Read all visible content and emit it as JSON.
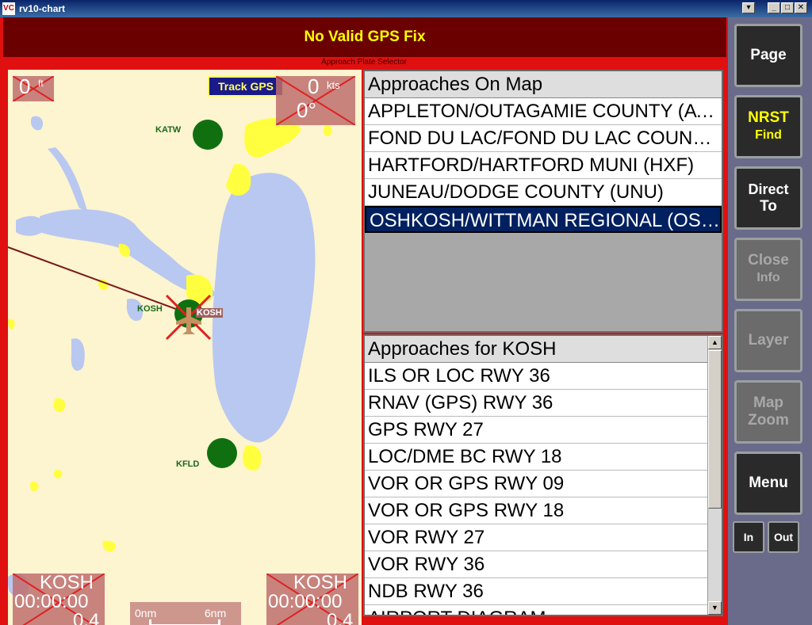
{
  "window": {
    "title": "rv10-chart",
    "app_icon": "VC"
  },
  "banner": {
    "text": "No Valid GPS Fix"
  },
  "selector_label": "Approach Plate Selector",
  "map": {
    "track_button": "Track GPS",
    "altitude": {
      "value": "0",
      "unit": "ft"
    },
    "speed": {
      "value": "0",
      "unit": "kts",
      "heading": "0°"
    },
    "airports": [
      {
        "id": "KATW"
      },
      {
        "id": "KOSH"
      },
      {
        "id": "KFLD"
      }
    ],
    "target_label": "KOSH",
    "bottom_left": {
      "waypoint": "KOSH",
      "time": "00:00:00",
      "distance": "0.4"
    },
    "bottom_right": {
      "waypoint": "KOSH",
      "time": "00:00:00",
      "distance": "0.4"
    },
    "scale": {
      "start": "0nm",
      "end": "6nm"
    }
  },
  "approaches_on_map": {
    "header": "Approaches On Map",
    "items": [
      "APPLETON/OUTAGAMIE COUNTY (ATW)",
      "FOND DU LAC/FOND DU LAC COUNTY (FLD)",
      "HARTFORD/HARTFORD MUNI (HXF)",
      "JUNEAU/DODGE COUNTY (UNU)",
      "OSHKOSH/WITTMAN REGIONAL (OSH)"
    ],
    "selected_index": 4
  },
  "approaches_for": {
    "header": "Approaches for KOSH",
    "items": [
      "ILS OR LOC RWY 36",
      "RNAV (GPS) RWY 36",
      "GPS RWY 27",
      "LOC/DME BC RWY 18",
      "VOR OR GPS RWY 09",
      "VOR OR GPS RWY 18",
      "VOR RWY 27",
      "VOR RWY 36",
      "NDB RWY 36",
      "AIRPORT DIAGRAM"
    ]
  },
  "sidebar": {
    "page": "Page",
    "nrst_line1": "NRST",
    "nrst_line2": "Find",
    "direct_line1": "Direct",
    "direct_line2": "To",
    "close_line1": "Close",
    "close_line2": "Info",
    "layer": "Layer",
    "zoom_line1": "Map",
    "zoom_line2": "Zoom",
    "menu": "Menu",
    "zoom_in": "In",
    "zoom_out": "Out"
  },
  "colors": {
    "frame_red": "#e01010",
    "banner_bg": "#6b0000",
    "banner_text": "#ffff00",
    "selected_row": "#002060",
    "water": "#b8c8f0",
    "urban": "#ffff40",
    "airport_green": "#107010"
  }
}
